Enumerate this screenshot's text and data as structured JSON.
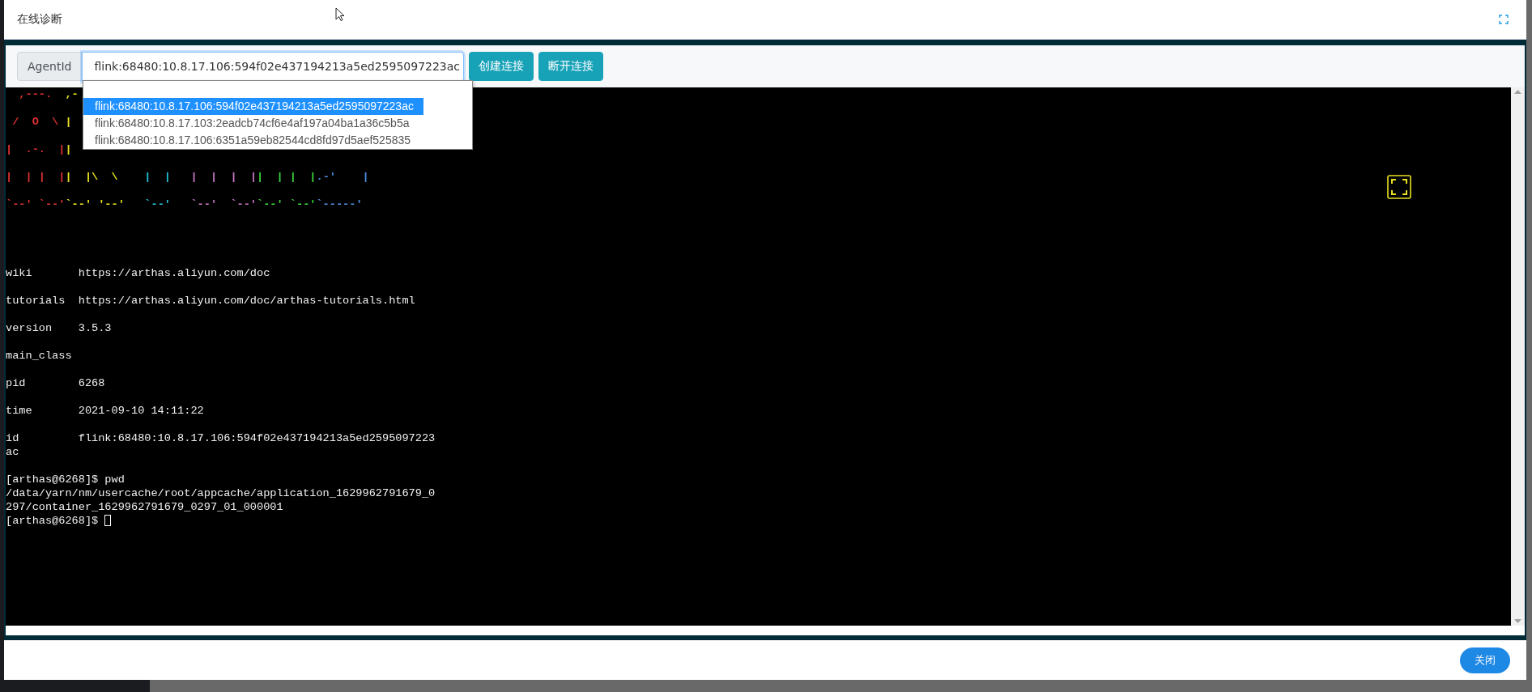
{
  "dialog": {
    "title": "在线诊断"
  },
  "toolbar": {
    "label": "AgentId",
    "select_value": "flink:68480:10.8.17.106:594f02e437194213a5ed2595097223ac",
    "options": [
      {
        "selected": false
      },
      {
        "text": "flink:68480:10.8.17.106:594f02e437194213a5ed2595097223ac",
        "selected": true
      },
      {
        "text": "flink:68480:10.8.17.103:2eadcb74cf6e4af197a04ba1a36c5b5a",
        "selected": false
      },
      {
        "text": "flink:68480:10.8.17.106:6351a59eb82544cd8fd97d5aef525835",
        "selected": false
      }
    ],
    "buttons": [
      "创建连接",
      "断开连接"
    ]
  },
  "terminal": {
    "art_rows": [
      [
        {
          "text": "  ,---.  ",
          "color": "#e03131"
        },
        {
          "text": ",-",
          "color": "#e8e020"
        }
      ],
      [
        {
          "text": " /  O  \\ ",
          "color": "#e03131"
        },
        {
          "text": "|",
          "color": "#e8e020"
        }
      ],
      [
        {
          "text": "|  .-.  |",
          "color": "#e03131"
        },
        {
          "text": "|",
          "color": "#e8e020"
        }
      ],
      [
        {
          "text": "|  | |  |",
          "color": "#e03131"
        },
        {
          "text": "|  |\\  \\ ",
          "color": "#e8e020"
        },
        {
          "text": "   |  |   ",
          "color": "#22c3d6"
        },
        {
          "text": "|  |  |  |",
          "color": "#c678c6"
        },
        {
          "text": "|  | |  |",
          "color": "#3cd43c"
        },
        {
          "text": ".-'    |",
          "color": "#4f8fe0"
        }
      ],
      [
        {
          "text": "`--' `--'",
          "color": "#e03131"
        },
        {
          "text": "`--' '--'",
          "color": "#e8e020"
        },
        {
          "text": "   `--'   ",
          "color": "#22c3d6"
        },
        {
          "text": "`--'  `--'",
          "color": "#c678c6"
        },
        {
          "text": "`--' `--'",
          "color": "#3cd43c"
        },
        {
          "text": "`-----'",
          "color": "#4f8fe0"
        }
      ]
    ],
    "blocks": [
      [
        "wiki       https://arthas.aliyun.com/doc"
      ],
      [
        "tutorials  https://arthas.aliyun.com/doc/arthas-tutorials.html"
      ],
      [
        "version    3.5.3"
      ],
      [
        "main_class"
      ],
      [
        "pid        6268"
      ],
      [
        "time       2021-09-10 14:11:22"
      ],
      [
        "id         flink:68480:10.8.17.106:594f02e437194213a5ed2595097223",
        "ac"
      ],
      [
        "[arthas@6268]$ pwd",
        "/data/yarn/nm/usercache/root/appcache/application_1629962791679_0",
        "297/container_1629962791679_0297_01_000001",
        "[arthas@6268]$ "
      ]
    ],
    "cursor": true
  },
  "footer": {
    "close_button": "关闭"
  }
}
